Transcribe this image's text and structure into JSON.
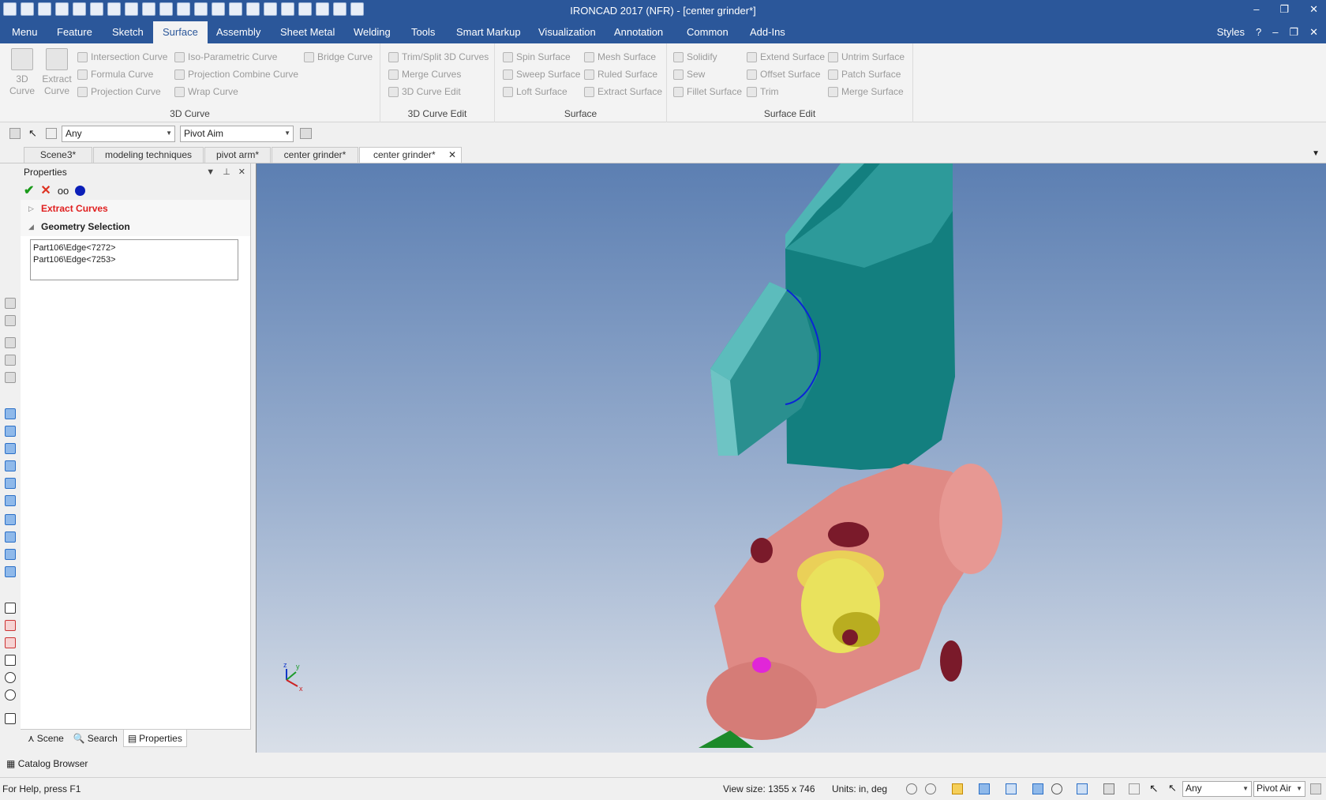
{
  "window": {
    "title": "IRONCAD 2017 (NFR) - [center grinder*]",
    "controls": [
      "–",
      "❐",
      "✕"
    ]
  },
  "menubar": {
    "tabs": [
      "Menu",
      "Feature",
      "Sketch",
      "Surface",
      "Assembly",
      "Sheet Metal",
      "Welding",
      "Tools",
      "Smart Markup",
      "Visualization",
      "Annotation",
      "Common",
      "Add-Ins"
    ],
    "active": "Surface",
    "styles_label": "Styles"
  },
  "ribbon": {
    "group_3dcurve": {
      "title": "3D Curve",
      "big_3d_curve": "3D Curve",
      "big_extract": "Extract Curve",
      "items": [
        "Intersection Curve",
        "Formula Curve",
        "Projection Curve",
        "Iso-Parametric Curve",
        "Projection Combine Curve",
        "Wrap Curve",
        "Bridge Curve"
      ]
    },
    "group_3dcurveedit": {
      "title": "3D Curve Edit",
      "items": [
        "Trim/Split 3D Curves",
        "Merge Curves",
        "3D Curve Edit"
      ]
    },
    "group_surface": {
      "title": "Surface",
      "items": [
        "Spin Surface",
        "Sweep Surface",
        "Loft Surface",
        "Mesh Surface",
        "Ruled Surface",
        "Extract Surface"
      ]
    },
    "group_surfaceedit": {
      "title": "Surface Edit",
      "items": [
        "Solidify",
        "Sew",
        "Fillet Surface",
        "Extend Surface",
        "Offset Surface",
        "Trim",
        "Untrim Surface",
        "Patch Surface",
        "Merge Surface"
      ]
    }
  },
  "selection_bar": {
    "filter_value": "Any",
    "pivot_value": "Pivot Aim"
  },
  "doc_tabs": [
    "Scene3*",
    "modeling techniques",
    "pivot arm*",
    "center grinder*",
    "center grinder*"
  ],
  "active_doc_tab": 4,
  "properties_panel": {
    "title": "Properties",
    "section_extract": "Extract Curves",
    "section_geometry": "Geometry Selection",
    "selection_items": [
      "Part106\\Edge<7272>",
      "Part106\\Edge<7253>"
    ],
    "tabs": [
      "Scene",
      "Search",
      "Properties"
    ]
  },
  "catalog_browser": "Catalog Browser",
  "statusbar": {
    "help": "For Help, press F1",
    "view_size": "View size: 1355 x 746",
    "units": "Units: in, deg",
    "filter_value": "Any",
    "pivot_value": "Pivot Air"
  },
  "axis_labels": {
    "z": "z",
    "y": "y",
    "x": "x"
  },
  "colors": {
    "title_blue": "#2b579a",
    "teal_part": "#1f8d8d",
    "pink_part": "#e08a86",
    "yellow_part": "#e6e15a",
    "selected_edge": "#0a24d6"
  }
}
